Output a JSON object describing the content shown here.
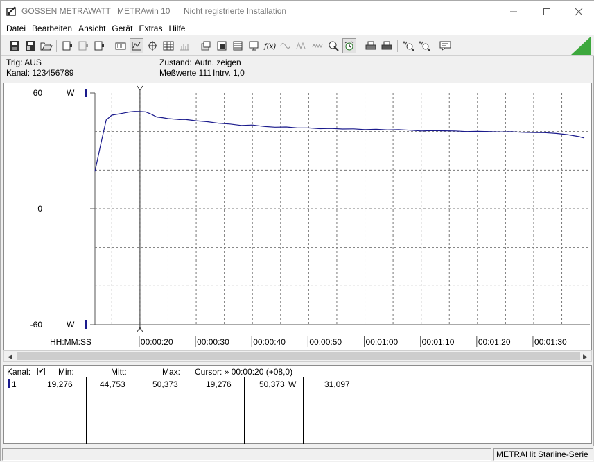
{
  "window": {
    "titles": [
      "GOSSEN METRAWATT",
      "METRAwin 10",
      "Nicht registrierte Installation"
    ]
  },
  "menu": [
    "Datei",
    "Bearbeiten",
    "Ansicht",
    "Gerät",
    "Extras",
    "Hilfe"
  ],
  "toolbar_icons": [
    "save-icon",
    "save-as-icon",
    "open-folder-icon",
    "device-1-icon",
    "device-2-icon",
    "device-3-icon",
    "keyboard-icon",
    "xy-chart-icon",
    "crosshair-icon",
    "table-icon",
    "bar-list-icon",
    "export-icon",
    "print-preview-icon",
    "data-grid-icon",
    "monitor-icon",
    "formula-icon",
    "wave-icon",
    "waveform-icon",
    "cursor-icon",
    "alarm-clock-icon",
    "printer-icon",
    "printer-2-icon",
    "zoom-wave-icon",
    "zoom-wave-2-icon",
    "comment-icon"
  ],
  "info": {
    "trig": "Trig: AUS",
    "kanal": "Kanal: 123456789",
    "zustand_label": "Zustand:",
    "zustand_value": "Aufn. zeigen",
    "messwerte": "Meßwerte 111",
    "intrv": "Intrv. 1,0"
  },
  "chart_data": {
    "type": "line",
    "ylim": [
      -60,
      60
    ],
    "y_unit": "W",
    "y_tick_labels": [
      "60",
      "0",
      "-60"
    ],
    "xlabel": "HH:MM:SS",
    "x_tick_labels": [
      "00:00:20",
      "00:00:30",
      "00:00:40",
      "00:00:50",
      "00:01:00",
      "00:01:10",
      "00:01:20",
      "00:01:30"
    ],
    "x_range_seconds": [
      12,
      99
    ],
    "grid": true,
    "cursor_time": "00:00:20",
    "series": [
      {
        "color": "#1a1a8c",
        "x": [
          12,
          13,
          14,
          15,
          16,
          17,
          18,
          19,
          20,
          21,
          22,
          23,
          24,
          25,
          26,
          27,
          28,
          30,
          32,
          34,
          36,
          38,
          40,
          42,
          44,
          46,
          48,
          50,
          52,
          54,
          56,
          58,
          60,
          62,
          64,
          66,
          68,
          70,
          72,
          74,
          76,
          78,
          80,
          82,
          84,
          86,
          88,
          90,
          92,
          94,
          96,
          98,
          99
        ],
        "values": [
          19.276,
          33,
          46,
          48.5,
          49,
          49.5,
          50.1,
          50.4,
          50.373,
          50.2,
          49.0,
          47.5,
          47.2,
          46.7,
          46.5,
          46.2,
          46.3,
          45.6,
          45.1,
          44.3,
          43.9,
          43.2,
          43.4,
          42.7,
          42.3,
          42.4,
          41.9,
          41.9,
          41.5,
          41.6,
          41.3,
          41.4,
          41.0,
          41.2,
          40.9,
          41.0,
          40.7,
          40.3,
          40.5,
          40.4,
          40.3,
          40.0,
          40.1,
          40.0,
          39.8,
          39.9,
          39.6,
          39.5,
          39.4,
          39.0,
          38.4,
          37.4,
          36.7
        ]
      }
    ]
  },
  "table": {
    "headers": {
      "kanal": "Kanal:",
      "min": "Min:",
      "mitt": "Mitt:",
      "max": "Max:",
      "cursor": "Cursor: » 00:00:20 (+08,0)"
    },
    "row": {
      "kanal": "1",
      "min": "19,276",
      "mitt": "44,753",
      "max": "50,373",
      "c1": "19,276",
      "c2": "50,373",
      "unit": "W",
      "c3": "31,097"
    }
  },
  "status": {
    "right": "METRAHit Starline-Serie"
  }
}
